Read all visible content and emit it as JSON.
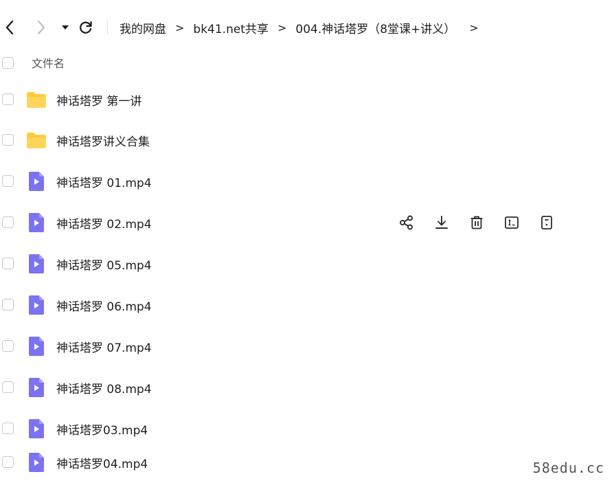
{
  "breadcrumb": {
    "items": [
      "我的网盘",
      "bk41.net共享",
      "004.神话塔罗（8堂课+讲义）"
    ],
    "separator": ">"
  },
  "list": {
    "header_label": "文件名",
    "files": [
      {
        "name": "神话塔罗 第一讲",
        "type": "folder"
      },
      {
        "name": "神话塔罗讲义合集",
        "type": "folder"
      },
      {
        "name": "神话塔罗 01.mp4",
        "type": "video"
      },
      {
        "name": "神话塔罗 02.mp4",
        "type": "video"
      },
      {
        "name": "神话塔罗 05.mp4",
        "type": "video"
      },
      {
        "name": "神话塔罗 06.mp4",
        "type": "video"
      },
      {
        "name": "神话塔罗 07.mp4",
        "type": "video"
      },
      {
        "name": "神话塔罗 08.mp4",
        "type": "video"
      },
      {
        "name": "神话塔罗03.mp4",
        "type": "video"
      },
      {
        "name": "神话塔罗04.mp4",
        "type": "video"
      }
    ]
  },
  "row_actions": [
    "share-icon",
    "download-icon",
    "delete-icon",
    "rename-icon",
    "more-icon"
  ],
  "watermark": "58edu.cc",
  "colors": {
    "folder": "#FFCB3C",
    "video": "#7B73F0",
    "icon": "#2b2b2b"
  }
}
